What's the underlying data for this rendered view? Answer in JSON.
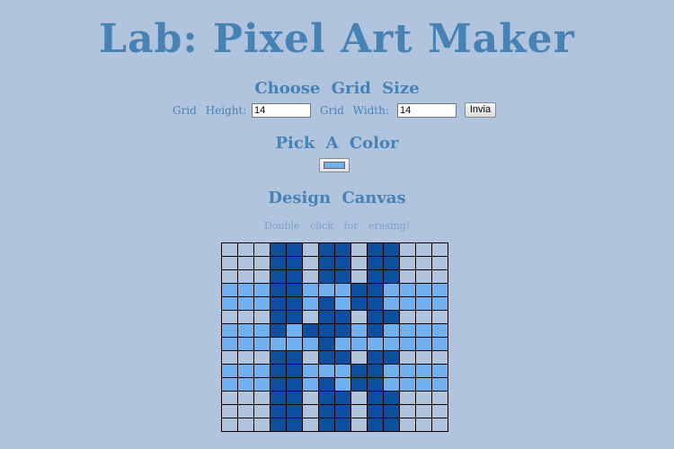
{
  "title": "Lab: Pixel Art Maker",
  "grid_section": {
    "heading": "Choose Grid Size",
    "height_label": "Grid Height:",
    "height_value": "14",
    "width_label": "Grid Width:",
    "width_value": "14",
    "submit_label": "Invia"
  },
  "color_section": {
    "heading": "Pick A Color",
    "selected_color": "#6fb1f0"
  },
  "canvas_section": {
    "heading": "Design Canvas",
    "hint": "Double click for erasing!",
    "palette": {
      "0": "#b0c4de",
      "1": "#0d4fa0",
      "2": "#6fb1f0"
    },
    "rows": [
      "00011011011000",
      "00011011011000",
      "00011011011000",
      "22211222112222",
      "22211212112222",
      "00011011011000",
      "22212111212222",
      "22222212222222",
      "00011011011000",
      "22211222112222",
      "22211212112222",
      "00011011011000",
      "00011011011000",
      "00011011011000"
    ]
  }
}
